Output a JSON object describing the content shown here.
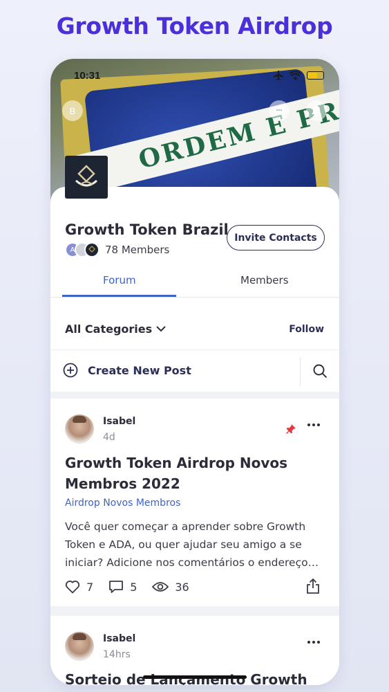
{
  "promo": {
    "title": "Growth Token Airdrop"
  },
  "status_bar": {
    "time": "10:31"
  },
  "cover": {
    "flag_text": "ORDEM E PROGR",
    "back_initial": "B"
  },
  "group": {
    "name": "Growth Token Brazil",
    "member_count": "78 Members",
    "avatar_initial": "A",
    "invite_label": "Invite Contacts"
  },
  "tabs": [
    {
      "label": "Forum",
      "active": true
    },
    {
      "label": "Members",
      "active": false
    }
  ],
  "filter": {
    "category_label": "All Categories",
    "follow_label": "Follow"
  },
  "composer": {
    "label": "Create New Post"
  },
  "posts": [
    {
      "author": "Isabel",
      "time": "4d",
      "pinned": true,
      "title": "Growth Token Airdrop Novos Membros 2022",
      "category": "Airdrop Novos Membros",
      "excerpt": "Você quer começar a aprender sobre Growth Token e ADA, ou quer ajudar seu amigo a se iniciar? Adicione nos comentários o endereço…",
      "likes": "7",
      "comments": "5",
      "views": "36"
    },
    {
      "author": "Isabel",
      "time": "14hrs",
      "pinned": false,
      "title": "Sorteio de Lançamento Growth"
    }
  ],
  "colors": {
    "brand_purple": "#4b2fd9",
    "accent_blue": "#3e63c9",
    "navy": "#2c2f55",
    "pin_red": "#e0393e"
  }
}
